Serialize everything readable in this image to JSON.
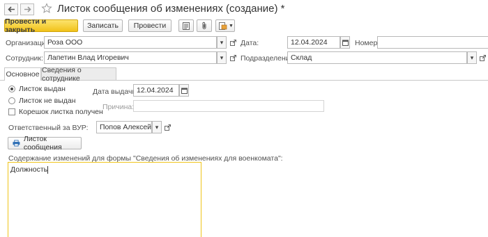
{
  "header": {
    "title": "Листок сообщения об изменениях (создание) *"
  },
  "toolbar": {
    "post_close_label": "Провести и закрыть",
    "save_label": "Записать",
    "post_label": "Провести"
  },
  "form": {
    "organization_label": "Организация:",
    "organization_value": "Роза ООО",
    "date_label": "Дата:",
    "date_value": "12.04.2024",
    "number_label": "Номер:",
    "number_value": "",
    "employee_label": "Сотрудник:",
    "employee_value": "Лапетин Влад Игоревич",
    "department_label": "Подразделение:",
    "department_value": "Склад"
  },
  "tabs": [
    {
      "label": "Основное",
      "active": true
    },
    {
      "label": "Сведения о сотруднике",
      "active": false
    }
  ],
  "main": {
    "radio_issued_label": "Листок выдан",
    "radio_not_issued_label": "Листок не выдан",
    "checkbox_stub_label": "Корешок листка получен",
    "issue_date_label": "Дата выдачи:",
    "issue_date_value": "12.04.2024",
    "reason_label": "Причина:",
    "reason_value": "",
    "responsible_label": "Ответственный за ВУР:",
    "responsible_value": "Попов Алексей Викторови",
    "print_button_label": "Листок сообщения",
    "content_label": "Содержание изменений для формы \"Сведения об изменениях для военкомата\":",
    "content_value": "Должность"
  },
  "icons": {
    "back": "arrow-left-icon",
    "forward": "arrow-right-icon",
    "favorite": "star-icon",
    "report": "report-icon",
    "attach": "paperclip-icon",
    "print_menu": "print-icon",
    "open": "open-link-icon",
    "calendar": "calendar-icon",
    "printer": "printer-icon"
  },
  "colors": {
    "primary_button": "#f1c21a",
    "content_border": "#f0c419",
    "print_icon": "#2e6fb5"
  }
}
